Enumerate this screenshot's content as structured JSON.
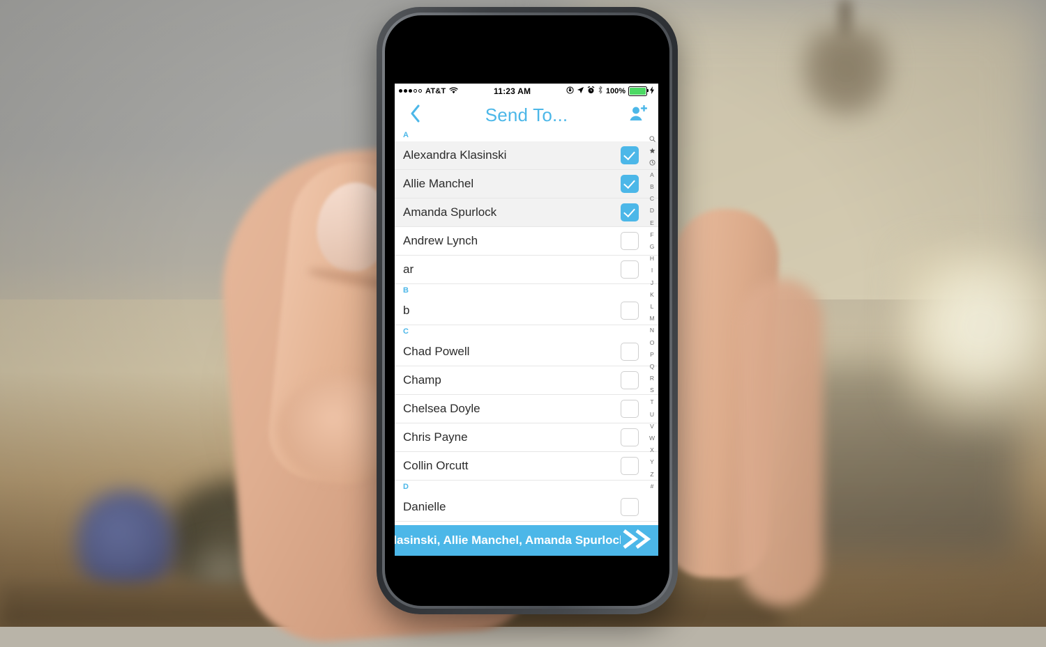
{
  "status_bar": {
    "carrier": "AT&T",
    "signal_dots_filled": 3,
    "signal_dots_hollow": 2,
    "wifi_icon": "wifi-icon",
    "time": "11:23 AM",
    "icons": [
      "rotation-lock-icon",
      "location-arrow-icon",
      "alarm-clock-icon",
      "bluetooth-icon"
    ],
    "battery_percent": "100%",
    "battery_color": "#4cd964",
    "charging_icon": "lightning-bolt-icon"
  },
  "nav_bar": {
    "back_icon": "chevron-left-icon",
    "title": "Send To...",
    "add_contact_icon": "add-person-icon",
    "accent_color": "#4cb7e8"
  },
  "contacts": [
    {
      "type": "section",
      "label": "A"
    },
    {
      "type": "contact",
      "name": "Alexandra Klasinski",
      "checked": true
    },
    {
      "type": "contact",
      "name": "Allie Manchel",
      "checked": true
    },
    {
      "type": "contact",
      "name": "Amanda Spurlock",
      "checked": true
    },
    {
      "type": "contact",
      "name": "Andrew Lynch",
      "checked": false
    },
    {
      "type": "contact",
      "name": "ar",
      "checked": false
    },
    {
      "type": "section",
      "label": "B"
    },
    {
      "type": "contact",
      "name": "b",
      "checked": false
    },
    {
      "type": "section",
      "label": "C"
    },
    {
      "type": "contact",
      "name": "Chad Powell",
      "checked": false
    },
    {
      "type": "contact",
      "name": "Champ",
      "checked": false
    },
    {
      "type": "contact",
      "name": "Chelsea Doyle",
      "checked": false
    },
    {
      "type": "contact",
      "name": "Chris Payne",
      "checked": false
    },
    {
      "type": "contact",
      "name": "Collin Orcutt",
      "checked": false
    },
    {
      "type": "section",
      "label": "D"
    },
    {
      "type": "contact",
      "name": "Danielle",
      "checked": false
    }
  ],
  "index_bar": {
    "icons": [
      "search-icon",
      "star-icon",
      "clock-icon"
    ],
    "letters": [
      "A",
      "B",
      "C",
      "D",
      "E",
      "F",
      "G",
      "H",
      "I",
      "J",
      "K",
      "L",
      "M",
      "N",
      "O",
      "P",
      "Q",
      "R",
      "S",
      "T",
      "U",
      "V",
      "W",
      "X",
      "Y",
      "Z",
      "#"
    ]
  },
  "send_bar": {
    "recipients_text": "Klasinski, Allie Manchel, Amanda Spurlock",
    "send_icon": "double-chevron-right-icon",
    "background_color": "#4cb7e8"
  }
}
